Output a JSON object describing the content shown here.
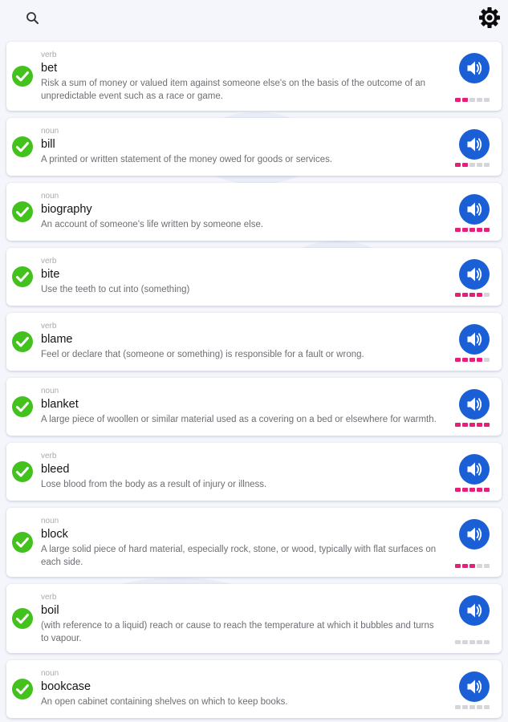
{
  "colors": {
    "accent": "#1a5fd6",
    "check": "#43c11d",
    "progress_on": "#e91e7a",
    "progress_off": "#d6d6da"
  },
  "topbar": {
    "search_icon": "search-icon",
    "settings_icon": "gear-icon"
  },
  "words": [
    {
      "pos": "verb",
      "word": "bet",
      "definition": "Risk a sum of money or valued item against someone else's on the basis of the outcome of an unpredictable event such as a race or game.",
      "learned": true,
      "level": 2
    },
    {
      "pos": "noun",
      "word": "bill",
      "definition": "A printed or written statement of the money owed for goods or services.",
      "learned": true,
      "level": 2
    },
    {
      "pos": "noun",
      "word": "biography",
      "definition": "An account of someone's life written by someone else.",
      "learned": true,
      "level": 5
    },
    {
      "pos": "verb",
      "word": "bite",
      "definition": "Use the teeth to cut into (something)",
      "learned": true,
      "level": 4
    },
    {
      "pos": "verb",
      "word": "blame",
      "definition": "Feel or declare that (someone or something) is responsible for a fault or wrong.",
      "learned": true,
      "level": 4
    },
    {
      "pos": "noun",
      "word": "blanket",
      "definition": "A large piece of woollen or similar material used as a covering on a bed or elsewhere for warmth.",
      "learned": true,
      "level": 5
    },
    {
      "pos": "verb",
      "word": "bleed",
      "definition": "Lose blood from the body as a result of injury or illness.",
      "learned": true,
      "level": 5
    },
    {
      "pos": "noun",
      "word": "block",
      "definition": "A large solid piece of hard material, especially rock, stone, or wood, typically with flat surfaces on each side.",
      "learned": true,
      "level": 3
    },
    {
      "pos": "verb",
      "word": "boil",
      "definition": "(with reference to a liquid) reach or cause to reach the temperature at which it bubbles and turns to vapour.",
      "learned": true,
      "level": 0
    },
    {
      "pos": "noun",
      "word": "bookcase",
      "definition": "An open cabinet containing shelves on which to keep books.",
      "learned": true,
      "level": 0
    }
  ],
  "progress_max": 5
}
